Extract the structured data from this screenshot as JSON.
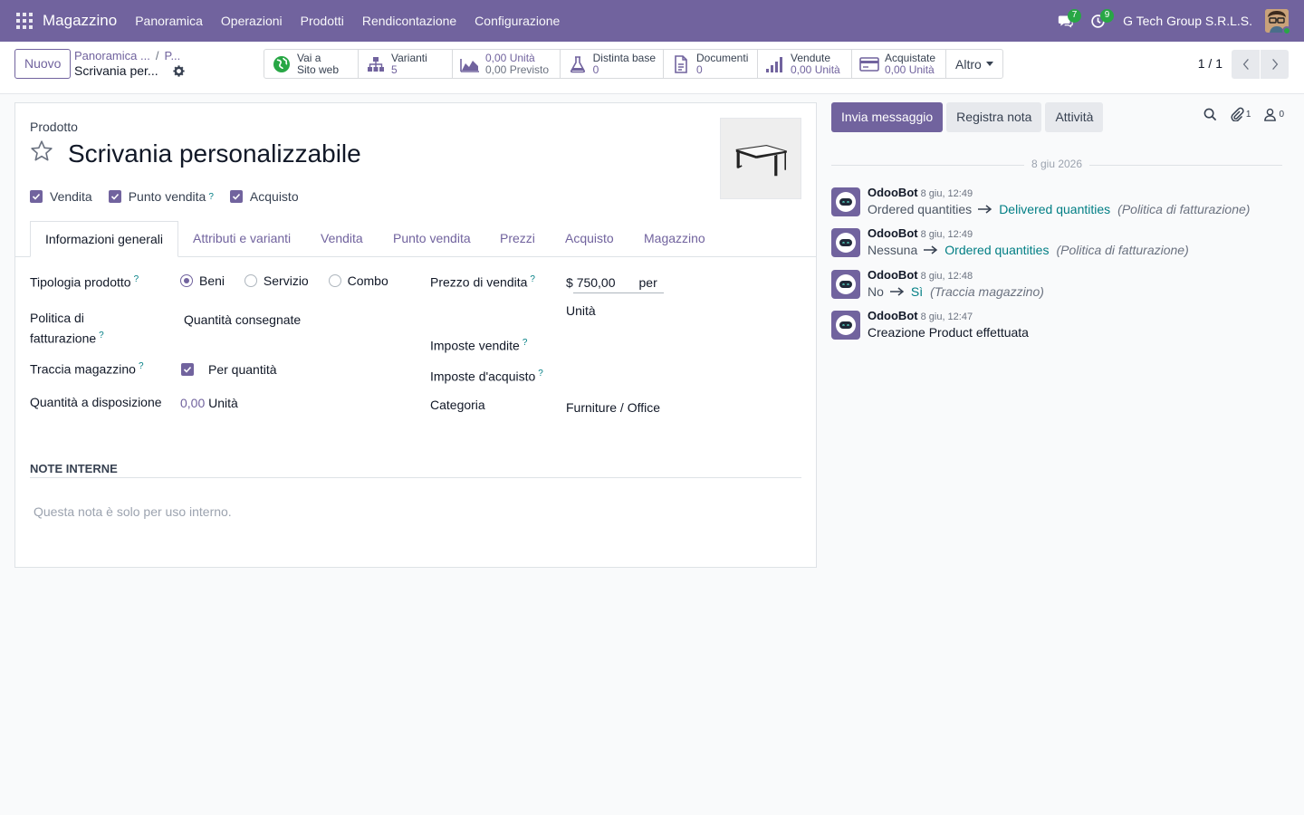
{
  "navbar": {
    "app_name": "Magazzino",
    "menu": [
      "Panoramica",
      "Operazioni",
      "Prodotti",
      "Rendicontazione",
      "Configurazione"
    ],
    "messages_count": "7",
    "activities_count": "9",
    "company": "G Tech Group S.R.L.S.",
    "accent_color": "#71639e"
  },
  "control_panel": {
    "new_button": "Nuovo",
    "breadcrumb_parent": "Panoramica ...",
    "breadcrumb_sep": "/",
    "breadcrumb_current": "P...",
    "record_name": "Scrivania per...",
    "smart_buttons": [
      {
        "icon": "globe-icon",
        "line1": "Vai a",
        "line2": "Sito web"
      },
      {
        "icon": "sitemap-icon",
        "line1": "Varianti",
        "line2": "5"
      },
      {
        "icon": "area-chart-icon",
        "line1": "0,00 Unità",
        "line2": "0,00 Previsto"
      },
      {
        "icon": "flask-icon",
        "line1": "Distinta base",
        "line2": "0"
      },
      {
        "icon": "document-icon",
        "line1": "Documenti",
        "line2": "0"
      },
      {
        "icon": "signal-icon",
        "line1": "Vendute",
        "line2": "0,00 Unità"
      },
      {
        "icon": "credit-card-icon",
        "line1": "Acquistate",
        "line2": "0,00 Unità"
      }
    ],
    "more_label": "Altro",
    "pager": "1 / 1"
  },
  "form": {
    "product_label": "Prodotto",
    "product_name": "Scrivania personalizzabile",
    "options": {
      "vendita": "Vendita",
      "punto_vendita": "Punto vendita",
      "acquisto": "Acquisto",
      "help_mark": "?"
    },
    "tabs": [
      "Informazioni generali",
      "Attributi e varianti",
      "Vendita",
      "Punto vendita",
      "Prezzi",
      "Acquisto",
      "Magazzino"
    ],
    "fields": {
      "tipologia_label": "Tipologia prodotto",
      "tipologia_options": [
        "Beni",
        "Servizio",
        "Combo"
      ],
      "tipologia_selected": "Beni",
      "politica_label_1": "Politica di",
      "politica_label_2": "fatturazione",
      "politica_value": "Quantità consegnate",
      "traccia_label": "Traccia magazzino",
      "traccia_value": "Per quantità",
      "quantita_label": "Quantità a disposizione",
      "quantita_value": "0,00",
      "quantita_uom": "Unità",
      "prezzo_label": "Prezzo di vendita",
      "prezzo_currency": "$",
      "prezzo_value": "750,00",
      "prezzo_per": "per",
      "prezzo_uom": "Unità",
      "imposte_vendite_label": "Imposte vendite",
      "imposte_acquisto_label": "Imposte d'acquisto",
      "categoria_label": "Categoria",
      "categoria_value": "Furniture / Office"
    },
    "notes_title": "NOTE INTERNE",
    "notes_placeholder": "Questa nota è solo per uso interno."
  },
  "chatter": {
    "send_message": "Invia messaggio",
    "log_note": "Registra nota",
    "activities": "Attività",
    "attachments_count": "1",
    "followers_count": "0",
    "date_separator": "8 giu 2026",
    "messages": [
      {
        "author": "OdooBot",
        "time": "8 giu, 12:49",
        "old": "Ordered quantities",
        "new": "Delivered quantities",
        "field": "(Politica di fatturazione)"
      },
      {
        "author": "OdooBot",
        "time": "8 giu, 12:49",
        "old": "Nessuna",
        "new": "Ordered quantities",
        "field": "(Politica di fatturazione)"
      },
      {
        "author": "OdooBot",
        "time": "8 giu, 12:48",
        "old": "No",
        "new": "Sì",
        "field": "(Traccia magazzino)"
      },
      {
        "author": "OdooBot",
        "time": "8 giu, 12:47",
        "text": "Creazione Product effettuata"
      }
    ]
  }
}
